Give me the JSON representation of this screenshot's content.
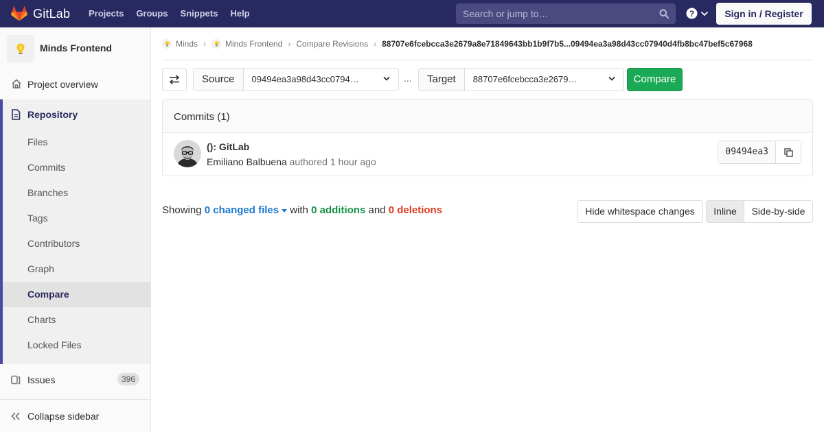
{
  "navbar": {
    "brand": "GitLab",
    "links": [
      "Projects",
      "Groups",
      "Snippets",
      "Help"
    ],
    "search_placeholder": "Search or jump to…",
    "signin_label": "Sign in / Register"
  },
  "sidebar": {
    "project_name": "Minds Frontend",
    "overview_label": "Project overview",
    "repository_label": "Repository",
    "repo_items": [
      "Files",
      "Commits",
      "Branches",
      "Tags",
      "Contributors",
      "Graph",
      "Compare",
      "Charts",
      "Locked Files"
    ],
    "active_item": "Compare",
    "issues_label": "Issues",
    "issues_count": "396",
    "collapse_label": "Collapse sidebar"
  },
  "breadcrumbs": {
    "items": [
      "Minds",
      "Minds Frontend",
      "Compare Revisions"
    ],
    "current": "88707e6fcebcca3e2679a8e71849643bb1b9f7b5...09494ea3a98d43cc07940d4fb8bc47bef5c67968"
  },
  "compare": {
    "source_label": "Source",
    "source_value": "09494ea3a98d43cc0794…",
    "separator": "...",
    "target_label": "Target",
    "target_value": "88707e6fcebcca3e2679…",
    "compare_label": "Compare"
  },
  "commits": {
    "header": "Commits (1)",
    "items": [
      {
        "title": "(): GitLab",
        "author": "Emiliano Balbuena",
        "action": "authored",
        "time": "1 hour ago",
        "sha": "09494ea3"
      }
    ]
  },
  "diff_summary": {
    "showing": "Showing",
    "changed_files": "0 changed files",
    "with": "with",
    "additions": "0 additions",
    "and": "and",
    "deletions": "0 deletions"
  },
  "diff_controls": {
    "whitespace_label": "Hide whitespace changes",
    "inline_label": "Inline",
    "side_by_side_label": "Side-by-side",
    "active_view": "Inline"
  },
  "colors": {
    "navbar": "#292961",
    "accent": "#4b4ba3",
    "success": "#1aaa55",
    "link": "#1f78d1",
    "danger": "#db3b21"
  }
}
